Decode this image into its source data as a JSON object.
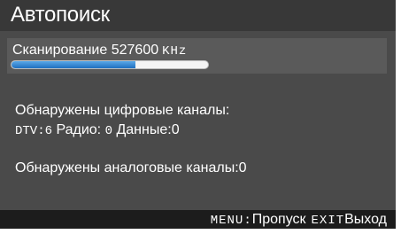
{
  "header": {
    "title": "Автопоиск"
  },
  "scan": {
    "label": "Сканирование",
    "frequency": "527600",
    "unit": "KHz",
    "progress_fraction": 0.63
  },
  "digital": {
    "label": "Обнаружены цифровые каналы:",
    "dtv_label": "DTV:",
    "dtv_count": "6",
    "radio_label": "Радио:",
    "radio_count": "0",
    "data_label": "Данные:",
    "data_count": "0"
  },
  "analog": {
    "label": "Обнаружены аналоговые каналы:",
    "count": "0"
  },
  "footer": {
    "menu_key": "MENU:",
    "menu_action": "Пропуск",
    "exit_key": "EXIT",
    "exit_action": "Выход"
  },
  "colors": {
    "panel_bg": "#4a4a4a",
    "title_bg": "#383838",
    "footer_bg": "#1c1c1c",
    "progress_fill": "#2a82d6"
  }
}
